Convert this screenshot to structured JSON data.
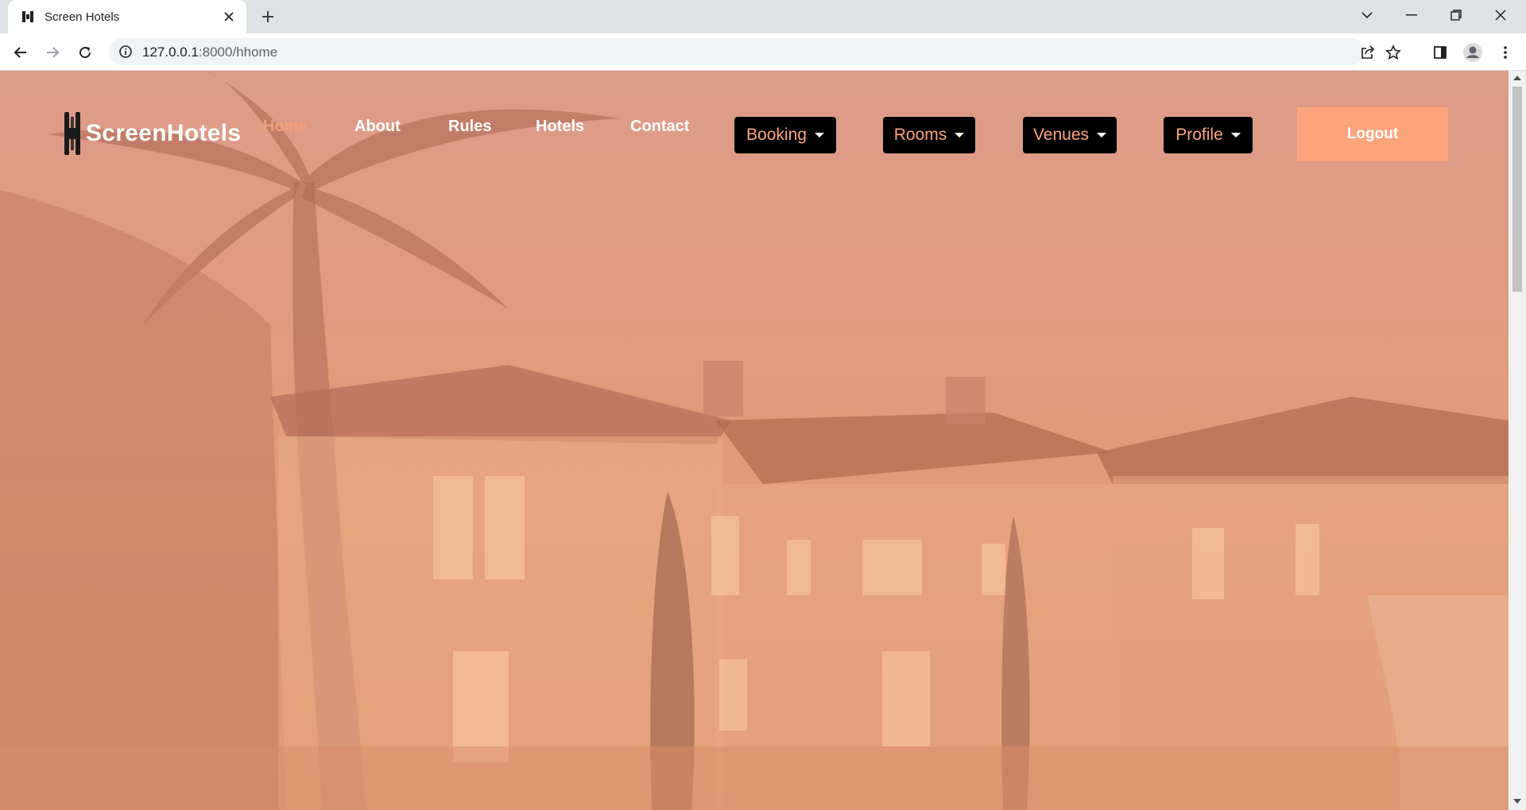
{
  "browser": {
    "tab_title": "Screen Hotels",
    "url_host": "127.0.0.1",
    "url_path": ":8000/hhome",
    "icons": [
      "favicon-icon",
      "close-icon",
      "new-tab-icon",
      "tab-search-icon",
      "minimize-icon",
      "maximize-icon",
      "close-window-icon",
      "back-icon",
      "forward-icon",
      "reload-icon",
      "site-info-icon",
      "share-icon",
      "bookmark-star-icon",
      "side-panel-icon",
      "profile-icon",
      "menu-icon"
    ]
  },
  "site": {
    "brand": "ScreenHotels",
    "nav": {
      "home": "Home",
      "about": "About",
      "rules": "Rules",
      "hotels": "Hotels",
      "contact": "Contact"
    },
    "dropdowns": {
      "booking": "Booking",
      "rooms": "Rooms",
      "venues": "Venues",
      "profile": "Profile"
    },
    "logout": "Logout",
    "colors": {
      "accent": "#fda47c",
      "overlay": "#e39a72",
      "dropdown_bg": "#000000"
    }
  }
}
